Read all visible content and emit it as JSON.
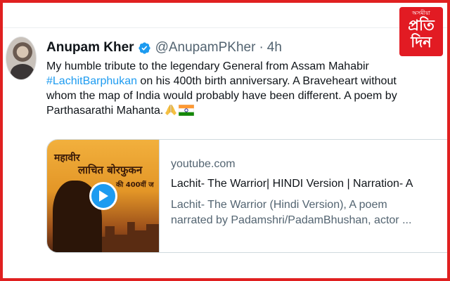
{
  "logo": {
    "small_text": "অসমীয়া",
    "big_line_1": "প্রতি",
    "big_line_2": "দিন",
    "colors": {
      "background": "#e21b23",
      "text": "#ffffff"
    }
  },
  "tweet": {
    "author_name": "Anupam Kher",
    "verified": true,
    "handle": "@AnupamPKher",
    "separator": "·",
    "time": "4h",
    "text_lines": [
      "My humble tribute to the legendary General from Assam Mahabir",
      "A Braveheart without",
      "whom the map of India would probably have been different. A poem by",
      "Parthasarathi Mahanta."
    ],
    "hashtag": "#LachitBarphukan",
    "hashtag_suffix": " on his 400th birth anniversary. ",
    "emojis": [
      "folded-hands-emoji",
      "india-flag-emoji"
    ],
    "colors": {
      "link": "#1d9bf0",
      "text": "#0f1419",
      "muted": "#536471"
    }
  },
  "card": {
    "thumbnail": {
      "line_1": "महावीर",
      "line_2": "लाचित बोरफुकन",
      "line_3": "की 400वीं ज"
    },
    "domain": "youtube.com",
    "title": "Lachit- The Warrior| HINDI Version | Narration- A",
    "description_lines": [
      "Lachit- The Warrior (Hindi Version), A poem",
      "narrated by Padamshri/PadamBhushan, actor ..."
    ]
  },
  "frame_color": "#e02020"
}
